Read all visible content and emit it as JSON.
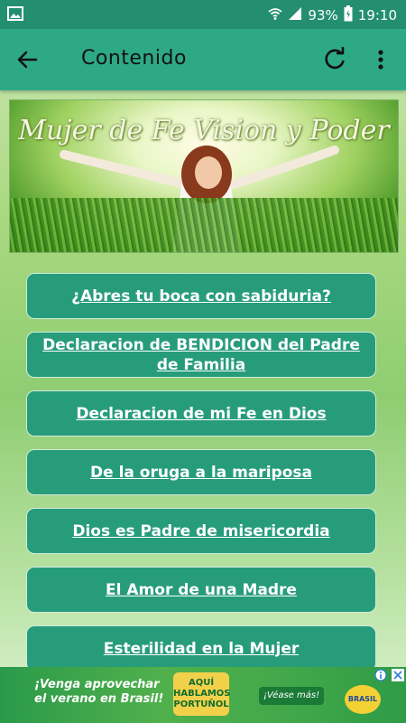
{
  "status": {
    "battery": "93%",
    "time": "19:10"
  },
  "toolbar": {
    "title": "Contenido"
  },
  "banner": {
    "title": "Mujer de Fe Vision y Poder"
  },
  "items": [
    {
      "label": "¿Abres tu boca con sabiduria?"
    },
    {
      "label": "Declaracion de BENDICION del Padre de Familia"
    },
    {
      "label": "Declaracion de mi Fe en Dios"
    },
    {
      "label": "De la oruga a la mariposa"
    },
    {
      "label": "Dios es Padre de misericordia"
    },
    {
      "label": "El Amor de una Madre"
    },
    {
      "label": "Esterilidad en la Mujer"
    }
  ],
  "ad": {
    "line1": "¡Venga aprovechar",
    "line2": "el verano en Brasil!",
    "logo_line1": "AQUÍ",
    "logo_line2": "HABLAMOS",
    "logo_line3": "PORTUÑOL",
    "cta": "¡Véase más!",
    "brand": "BRASIL"
  },
  "colors": {
    "accent": "#2ea986",
    "status_bar": "#248f70",
    "item_bg": "#279c7b"
  }
}
